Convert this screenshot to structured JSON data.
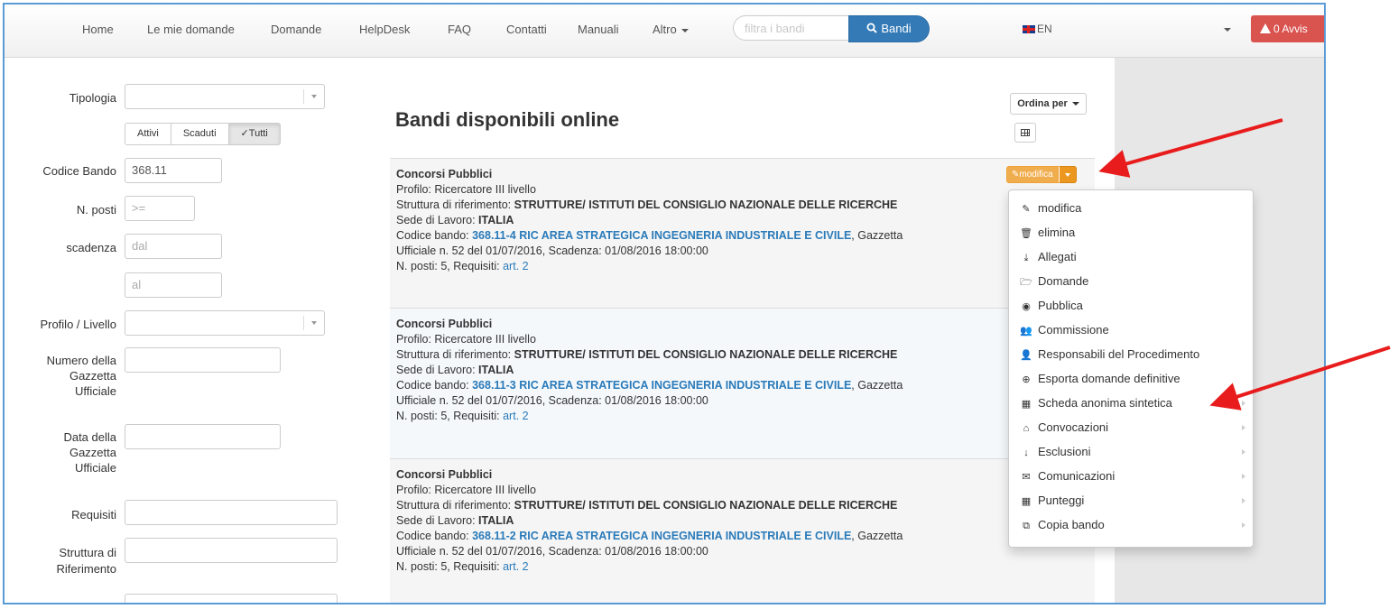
{
  "nav": {
    "items": [
      "Home",
      "Le mie domande",
      "Domande",
      "HelpDesk",
      "FAQ",
      "Contatti",
      "Manuali",
      "Altro"
    ],
    "search_placeholder": "filtra i bandi",
    "search_button": "Bandi",
    "language": "EN",
    "alerts": "0 Avvis"
  },
  "filters": {
    "tipologia_label": "Tipologia",
    "state_buttons": [
      "Attivi",
      "Scaduti",
      "Tutti"
    ],
    "active_state": "Tutti",
    "codice_label": "Codice Bando",
    "codice_value": "368.11",
    "nposti_label": "N. posti",
    "nposti_placeholder": ">=",
    "scadenza_label": "scadenza",
    "scadenza_dal": "dal",
    "scadenza_al": "al",
    "profilo_label": "Profilo / Livello",
    "numero_label_1": "Numero della",
    "numero_label_2": "Gazzetta",
    "numero_label_3": "Ufficiale",
    "data_label_1": "Data della",
    "data_label_2": "Gazzetta",
    "data_label_3": "Ufficiale",
    "requisiti_label": "Requisiti",
    "struttura_label_1": "Struttura di",
    "struttura_label_2": "Riferimento"
  },
  "main": {
    "title": "Bandi disponibili online",
    "sort_button": "Ordina per",
    "edit_button": "modifica",
    "cards": [
      {
        "category": "Concorsi Pubblici",
        "profilo": "Profilo: Ricercatore III livello",
        "struttura_prefix": "Struttura di riferimento: ",
        "struttura": "STRUTTURE/ ISTITUTI DEL CONSIGLIO NAZIONALE DELLE RICERCHE",
        "sede_prefix": "Sede di Lavoro: ",
        "sede": "ITALIA",
        "codice_prefix": "Codice bando: ",
        "codice": "368.11-4 RIC AREA STRATEGICA INGEGNERIA INDUSTRIALE E CIVILE",
        "codice_suffix": ", Gazzetta",
        "gazzetta": "Ufficiale n. 52 del 01/07/2016, Scadenza: 01/08/2016 18:00:00",
        "posti_prefix": "N. posti: 5, Requisiti: ",
        "requisiti": "art. 2"
      },
      {
        "category": "Concorsi Pubblici",
        "profilo": "Profilo: Ricercatore III livello",
        "struttura_prefix": "Struttura di riferimento: ",
        "struttura": "STRUTTURE/ ISTITUTI DEL CONSIGLIO NAZIONALE DELLE RICERCHE",
        "sede_prefix": "Sede di Lavoro: ",
        "sede": "ITALIA",
        "codice_prefix": "Codice bando: ",
        "codice": "368.11-3 RIC AREA STRATEGICA INGEGNERIA INDUSTRIALE E CIVILE",
        "codice_suffix": ", Gazzetta",
        "gazzetta": "Ufficiale n. 52 del 01/07/2016, Scadenza: 01/08/2016 18:00:00",
        "posti_prefix": "N. posti: 5, Requisiti: ",
        "requisiti": "art. 2"
      },
      {
        "category": "Concorsi Pubblici",
        "profilo": "Profilo: Ricercatore III livello",
        "struttura_prefix": "Struttura di riferimento: ",
        "struttura": "STRUTTURE/ ISTITUTI DEL CONSIGLIO NAZIONALE DELLE RICERCHE",
        "sede_prefix": "Sede di Lavoro: ",
        "sede": "ITALIA",
        "codice_prefix": "Codice bando: ",
        "codice": "368.11-2 RIC AREA STRATEGICA INGEGNERIA INDUSTRIALE E CIVILE",
        "codice_suffix": ", Gazzetta",
        "gazzetta": "Ufficiale n. 52 del 01/07/2016, Scadenza: 01/08/2016 18:00:00",
        "posti_prefix": "N. posti: 5, Requisiti: ",
        "requisiti": "art. 2"
      }
    ]
  },
  "dropdown": {
    "items": [
      {
        "label": "modifica",
        "icon": "pencil-icon",
        "glyph": "✎",
        "submenu": false
      },
      {
        "label": "elimina",
        "icon": "trash-icon",
        "glyph": "🗑",
        "submenu": false
      },
      {
        "label": "Allegati",
        "icon": "download-icon",
        "glyph": "⤓",
        "submenu": false
      },
      {
        "label": "Domande",
        "icon": "folder-open-icon",
        "glyph": "🗁",
        "submenu": false
      },
      {
        "label": "Pubblica",
        "icon": "eye-slash-icon",
        "glyph": "◉",
        "submenu": false
      },
      {
        "label": "Commissione",
        "icon": "users-icon",
        "glyph": "👥",
        "submenu": false
      },
      {
        "label": "Responsabili del Procedimento",
        "icon": "user-icon",
        "glyph": "👤",
        "submenu": false
      },
      {
        "label": "Esporta domande definitive",
        "icon": "export-icon",
        "glyph": "⊕",
        "submenu": false
      },
      {
        "label": "Scheda anonima sintetica",
        "icon": "table-icon",
        "glyph": "▦",
        "submenu": true
      },
      {
        "label": "Convocazioni",
        "icon": "inbox-icon",
        "glyph": "⌂",
        "submenu": true
      },
      {
        "label": "Esclusioni",
        "icon": "arrow-down-icon",
        "glyph": "↓",
        "submenu": true
      },
      {
        "label": "Comunicazioni",
        "icon": "envelope-icon",
        "glyph": "✉",
        "submenu": true
      },
      {
        "label": "Punteggi",
        "icon": "table-icon",
        "glyph": "▦",
        "submenu": true
      },
      {
        "label": "Copia bando",
        "icon": "copy-icon",
        "glyph": "⧉",
        "submenu": true
      }
    ]
  },
  "colors": {
    "accent": "#337ab7",
    "link": "#2a7ab9",
    "warning": "#f0ad4e",
    "danger": "#d9534f",
    "annotation_arrow": "#e81c1c"
  }
}
